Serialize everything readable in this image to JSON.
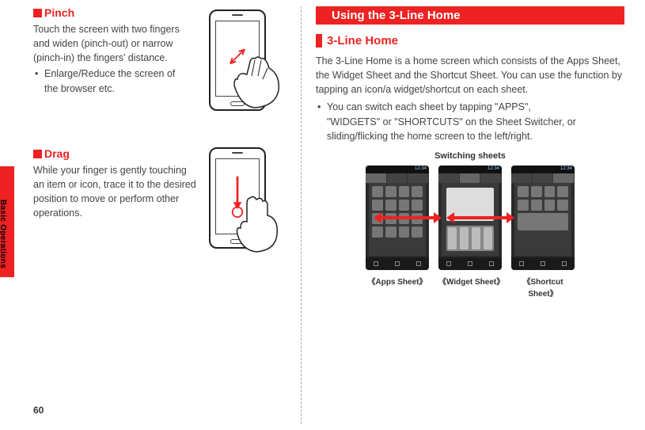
{
  "page_number": "60",
  "side_tab": "Basic Operations",
  "left": {
    "pinch": {
      "title": "Pinch",
      "body": "Touch the screen with two fingers and widen (pinch-out) or narrow (pinch-in) the fingers' distance.",
      "bullet": "Enlarge/Reduce the screen of the browser etc."
    },
    "drag": {
      "title": "Drag",
      "body": "While your finger is gently touching an item or icon, trace it to the desired position to move or perform other operations."
    }
  },
  "right": {
    "bar_title": "Using the 3-Line Home",
    "sub_title": "3-Line Home",
    "body": "The 3-Line Home is a home screen which consists of the Apps Sheet, the Widget Sheet and the Shortcut Sheet. You can use the function by tapping an icon/a widget/shortcut on each sheet.",
    "bullet": "You can switch each sheet by tapping \"APPS\", \"WIDGETS\" or \"SHORTCUTS\" on the Sheet Switcher, or sliding/flicking the home screen to the left/right.",
    "switch_caption": "Switching sheets",
    "labels": {
      "apps": "《Apps Sheet》",
      "widget": "《Widget Sheet》",
      "shortcut": "《Shortcut Sheet》"
    },
    "time": "12:34"
  }
}
